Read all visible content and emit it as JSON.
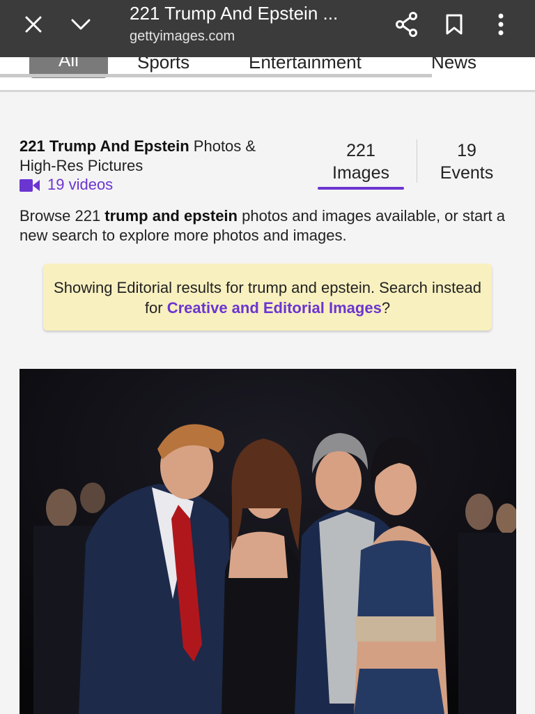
{
  "browser": {
    "title": "221 Trump And Epstein ...",
    "url": "gettyimages.com",
    "icons": [
      "close-icon",
      "chevron-down-icon",
      "share-icon",
      "bookmark-icon",
      "more-vert-icon"
    ]
  },
  "category_tabs": [
    {
      "label": "All",
      "selected": true
    },
    {
      "label": "Sports"
    },
    {
      "label": "Entertainment"
    },
    {
      "label": "News"
    }
  ],
  "header": {
    "title_bold": "221 Trump And Epstein",
    "title_rest": " Photos & High-Res Pictures",
    "videos_label": "19 videos"
  },
  "counts": {
    "images_number": "221",
    "images_label": "Images",
    "events_number": "19",
    "events_label": "Events"
  },
  "browse": {
    "prefix": "Browse 221 ",
    "query": "trump and epstein",
    "suffix": " photos and images available, or start a new search to explore more photos and images."
  },
  "notice": {
    "text": "Showing Editorial results for trump and epstein. Search instead for ",
    "link": "Creative and Editorial Images",
    "end": "?"
  },
  "colors": {
    "accent": "#6b35d1",
    "topbar": "#3b3b3b",
    "notice_bg": "#f8f0bf"
  }
}
